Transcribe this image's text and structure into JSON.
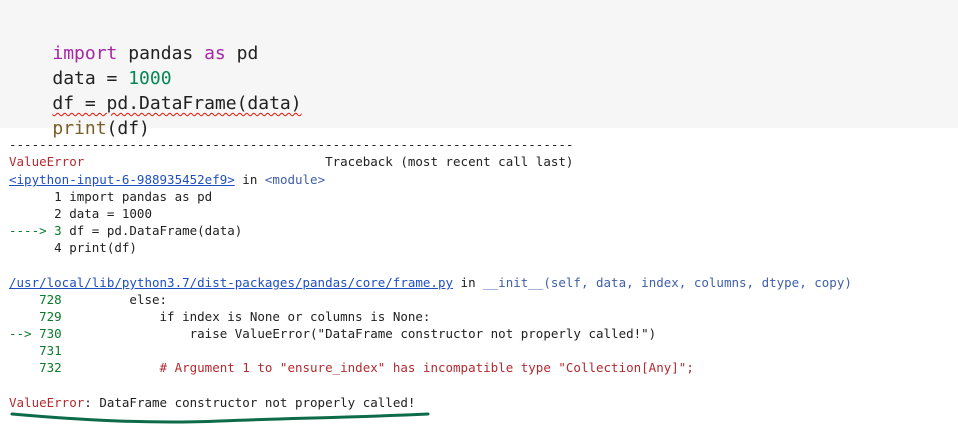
{
  "code_cell": {
    "lines": [
      {
        "parts": [
          {
            "t": "import",
            "c": "kw"
          },
          {
            "t": " pandas ",
            "c": ""
          },
          {
            "t": "as",
            "c": "kw"
          },
          {
            "t": " pd",
            "c": ""
          }
        ]
      },
      {
        "parts": [
          {
            "t": "data = ",
            "c": ""
          },
          {
            "t": "1000",
            "c": "num"
          }
        ]
      },
      {
        "parts": [
          {
            "t": "df = pd.DataFrame(data)",
            "c": "squiggle"
          }
        ]
      },
      {
        "parts": [
          {
            "t": "print",
            "c": "fn"
          },
          {
            "t": "(df)",
            "c": ""
          }
        ]
      }
    ]
  },
  "output": {
    "separator": "---------------------------------------------------------------------------",
    "error_type": "ValueError",
    "traceback_header": "Traceback (most recent call last)",
    "input_link": "<ipython-input-6-988935452ef9>",
    "in_word": " in ",
    "module": "<module>",
    "cell_lines": [
      "      1 import pandas as pd",
      "      2 data = 1000",
      "----> 3 df = pd.DataFrame(data)",
      "      4 print(df)"
    ],
    "frame_path": "/usr/local/lib/python3.7/dist-packages/pandas/core/frame.py",
    "frame_func": "__init__(self, data, index, columns, dtype, copy)",
    "frame_lines": [
      "    728         else:",
      "    729             if index is None or columns is None:",
      "--> 730                 raise ValueError(\"DataFrame constructor not properly called!\")",
      "    731",
      "    732             # Argument 1 to \"ensure_index\" has incompatible type \"Collection[Any]\";"
    ],
    "final_error_type": "ValueError",
    "final_error_msg": ": DataFrame constructor not properly called!"
  },
  "colors": {
    "keyword": "#a626a4",
    "number": "#098658",
    "error_red": "#b22b31",
    "arrow_green": "#0b7a2b",
    "link_blue": "#1f4fbf",
    "annotation_underline": "#0e6b4a"
  }
}
